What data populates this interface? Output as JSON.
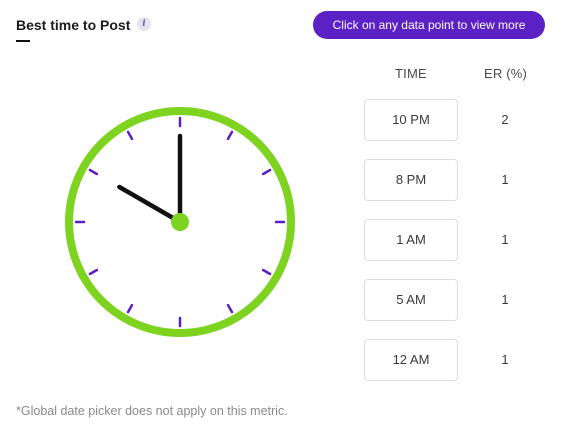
{
  "header": {
    "title": "Best time to Post",
    "info_icon": "info-icon",
    "cta_label": "Click on any data point to view more",
    "cta_color": "#5b21c4"
  },
  "table": {
    "columns": [
      "TIME",
      "ER (%)"
    ],
    "rows": [
      {
        "time": "10 PM",
        "er": "2"
      },
      {
        "time": "8 PM",
        "er": "1"
      },
      {
        "time": "1 AM",
        "er": "1"
      },
      {
        "time": "5 AM",
        "er": "1"
      },
      {
        "time": "12 AM",
        "er": "1"
      }
    ]
  },
  "clock": {
    "hour": 10,
    "minute": 0,
    "ring_color": "#7ed321",
    "tick_color": "#5b21c4",
    "hand_color": "#111111"
  },
  "footnote": "*Global date picker does not apply on this metric."
}
